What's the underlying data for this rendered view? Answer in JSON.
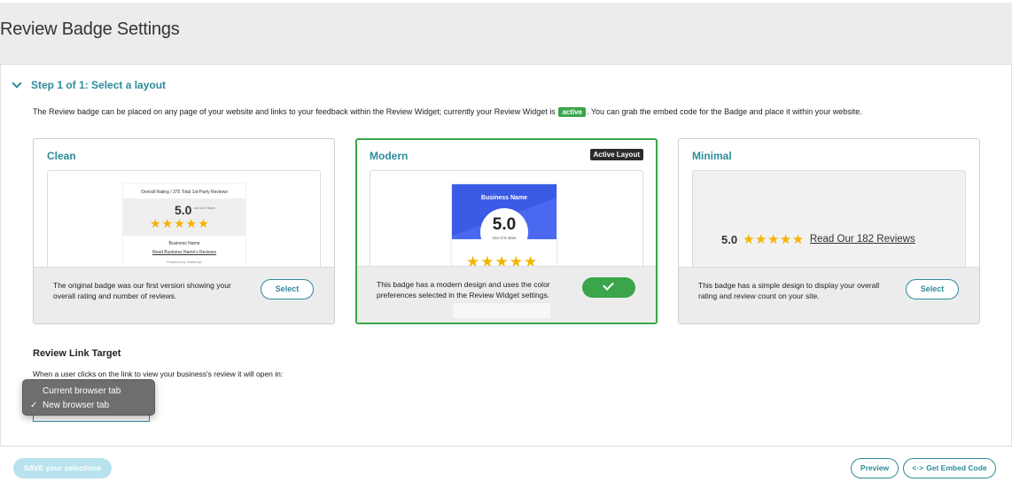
{
  "page_title": "Review Badge Settings",
  "step": {
    "title": "Step 1 of 1: Select a layout",
    "intro_before": "The Review badge can be placed on any page of your website and links to your feedback within the Review Widget; currently your Review Widget is ",
    "status": "active",
    "intro_after": ". You can grab the embed code for the Badge and place it within your website."
  },
  "layouts": [
    {
      "name": "Clean",
      "description": "The original badge was our first version showing your overall rating and number of reviews.",
      "button": "Select",
      "preview": {
        "heading": "Overall Rating / 375 Total 1st-Party Reviews",
        "score": "5.0",
        "score_sub": "out of 5 Stars",
        "stars": "★★★★★",
        "business": "Business Name",
        "link": "Read Business Name's Reviews",
        "powered": "Powered by GatherUp"
      }
    },
    {
      "name": "Modern",
      "tag": "Active Layout",
      "description": "This badge has a modern design and uses the color preferences selected in the Review Widget settings.",
      "preview": {
        "business": "Business Name",
        "score": "5.0",
        "score_sub": "Out of 5 stars",
        "stars": "★★★★★"
      }
    },
    {
      "name": "Minimal",
      "description": "This badge has a simple design to display your overall rating and review count on your site.",
      "button": "Select",
      "preview": {
        "score": "5.0",
        "stars": "★★★★★",
        "link": "Read Our 182 Reviews"
      }
    }
  ],
  "review_link": {
    "title": "Review Link Target",
    "description": "When a user clicks on the link to view your business's review it will open in:",
    "options": [
      "Current browser tab",
      "New browser tab"
    ],
    "selected_mark": "✓"
  },
  "footer": {
    "save": "SAVE your selections",
    "preview": "Preview",
    "embed_icon": "<·>",
    "embed": "Get Embed Code"
  },
  "colors": {
    "accent": "#2e8b9b",
    "active_green": "#3aa54a",
    "star": "#f4b400",
    "modern_blue": "#3b5ae6"
  }
}
